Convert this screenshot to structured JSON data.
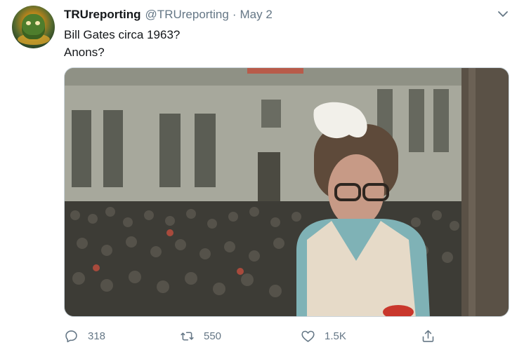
{
  "tweet": {
    "author_name": "TRUreporting",
    "author_handle": "@TRUreporting",
    "separator": "·",
    "date": "May 2",
    "text_lines": [
      "Bill Gates circa 1963?",
      "Anons?"
    ],
    "media": {
      "icon": "photo",
      "description_hidden": true
    },
    "actions": {
      "reply_count": "318",
      "retweet_count": "550",
      "like_count": "1.5K"
    }
  },
  "colors": {
    "text_primary": "#14171a",
    "text_secondary": "#657786",
    "border": "#ccd6dd"
  },
  "icons": [
    "avatar",
    "chevron-down-icon",
    "reply-icon",
    "retweet-icon",
    "like-icon",
    "share-icon"
  ]
}
